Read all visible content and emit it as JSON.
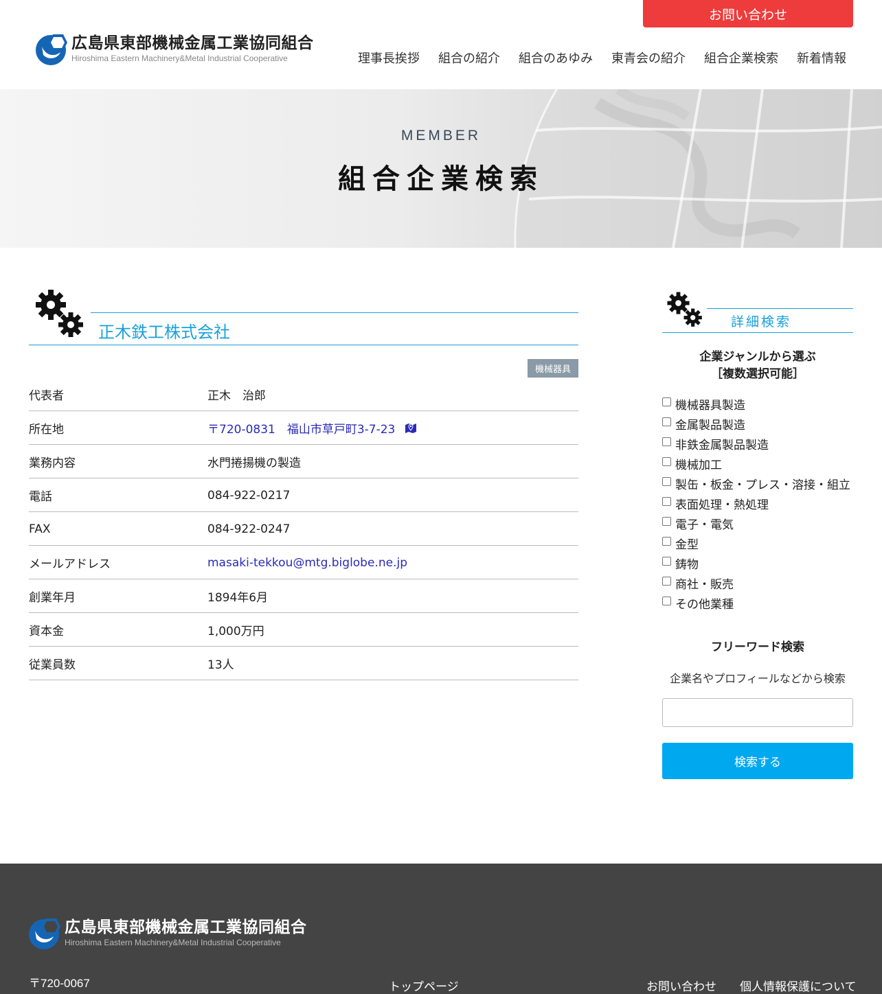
{
  "header": {
    "contact_label": "お問い合わせ",
    "logo_jp": "広島県東部機械金属工業協同組合",
    "logo_en": "Hiroshima Eastern Machinery&Metal Industrial Cooperative",
    "nav": [
      "理事長挨拶",
      "組合の紹介",
      "組合のあゆみ",
      "東青会の紹介",
      "組合企業検索",
      "新着情報"
    ]
  },
  "hero": {
    "subtitle": "MEMBER",
    "title": "組合企業検索"
  },
  "company": {
    "name": "正木鉄工株式会社",
    "genre_tag": "機械器具",
    "rows": [
      {
        "key": "代表者",
        "value": "正木　治郎"
      },
      {
        "key": "所在地",
        "value": "〒720-0831　福山市草戸町3-7-23"
      },
      {
        "key": "業務内容",
        "value": "水門捲揚機の製造"
      },
      {
        "key": "電話",
        "value": "084-922-0217"
      },
      {
        "key": "FAX",
        "value": "084-922-0247"
      },
      {
        "key": "メールアドレス",
        "value": "masaki-tekkou@mtg.biglobe.ne.jp"
      },
      {
        "key": "創業年月",
        "value": "1894年6月"
      },
      {
        "key": "資本金",
        "value": "1,000万円"
      },
      {
        "key": "従業員数",
        "value": "13人"
      }
    ]
  },
  "sidebar": {
    "title": "詳細検索",
    "genre_heading_1": "企業ジャンルから選ぶ",
    "genre_heading_2": "［複数選択可能］",
    "genres": [
      "機械器具製造",
      "金属製品製造",
      "非鉄金属製品製造",
      "機械加工",
      "製缶・板金・プレス・溶接・組立",
      "表面処理・熱処理",
      "電子・電気",
      "金型",
      "鋳物",
      "商社・販売",
      "その他業種"
    ],
    "free_heading": "フリーワード検索",
    "free_desc": "企業名やプロフィールなどから検索",
    "search_value": "",
    "search_button": "検索する"
  },
  "footer": {
    "logo_jp": "広島県東部機械金属工業協同組合",
    "logo_en": "Hiroshima Eastern Machinery&Metal Industrial Cooperative",
    "postal": "〒720-0067",
    "links": [
      "トップページ",
      "お問い合わせ",
      "個人情報保護について"
    ]
  },
  "colors": {
    "accent": "#1aa1d8",
    "contact": "#ee3b3b",
    "button": "#00a8f0",
    "footer": "#444444"
  }
}
